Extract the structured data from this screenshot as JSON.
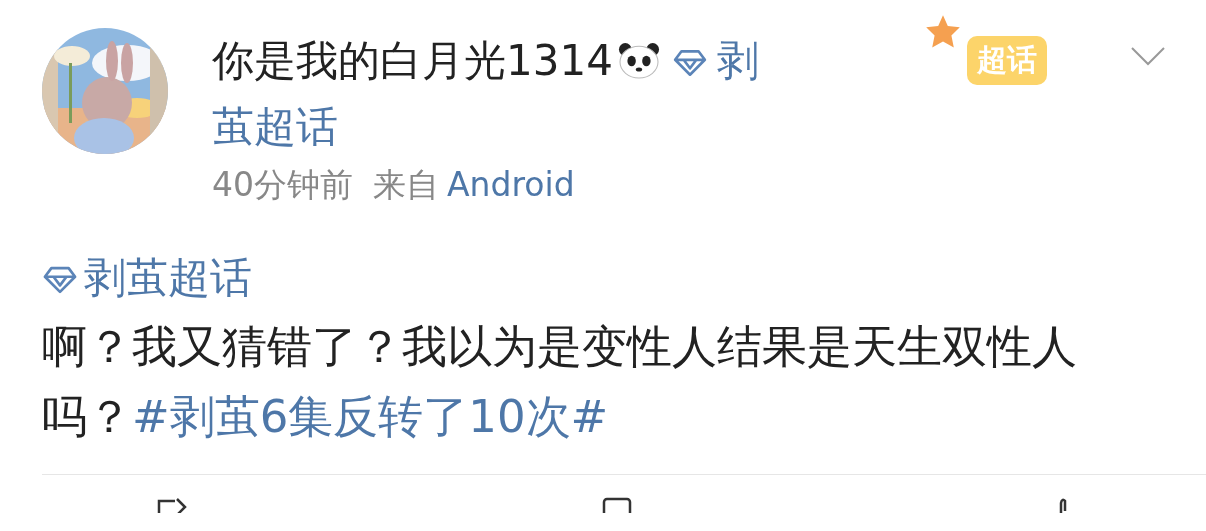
{
  "post": {
    "author": "你是我的白月光1314",
    "author_topic_lines": [
      "剥",
      "茧超话"
    ],
    "time": "40分钟前",
    "source_prefix": "来自",
    "source": "Android",
    "badge": "超话",
    "topic": "剥茧超话",
    "text": "啊？我又猜错了？我以为是变性人结果是天生双性人吗？",
    "hashtag": "#剥茧6集反转了10次#"
  }
}
